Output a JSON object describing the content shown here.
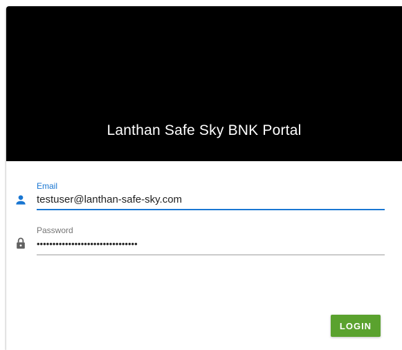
{
  "header": {
    "title": "Lanthan Safe Sky BNK Portal"
  },
  "form": {
    "email": {
      "label": "Email",
      "value": "testuser@lanthan-safe-sky.com",
      "icon": "person-icon"
    },
    "password": {
      "label": "Password",
      "value": "••••••••••••••••••••••••••••••••",
      "icon": "lock-icon"
    },
    "login_label": "LOGIN"
  },
  "colors": {
    "header_background": "#000000",
    "accent": "#1976d2",
    "login_button": "#5aa22e"
  }
}
